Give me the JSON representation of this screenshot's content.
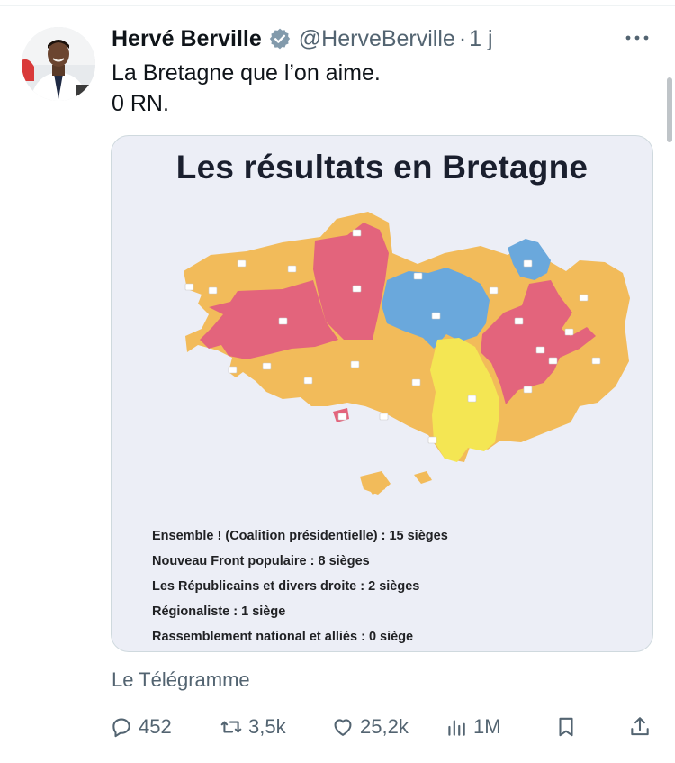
{
  "tweet": {
    "author_name": "Hervé Berville",
    "handle": "@HerveBerville",
    "separator": "·",
    "time": "1 j",
    "text_lines": [
      "La Bretagne que l’on aime.",
      "0 RN."
    ],
    "source_label": "Le Télégramme"
  },
  "media": {
    "title": "Les résultats en Bretagne",
    "legend": [
      "Ensemble ! (Coalition présidentielle) : 15 sièges",
      "Nouveau Front populaire : 8 sièges",
      "Les Républicains et divers droite : 2 sièges",
      "Régionaliste : 1 siège",
      "Rassemblement national et alliés : 0 siège"
    ],
    "colors": {
      "ensemble": "#f2bb5a",
      "nfp": "#e3647c",
      "lr": "#6aa8dc",
      "regionaliste": "#f4e653",
      "background": "#eceef6"
    }
  },
  "actions": {
    "replies": "452",
    "retweets": "3,5k",
    "likes": "25,2k",
    "views": "1M"
  },
  "icons": {
    "verified": "verified-badge-icon",
    "more": "more-options-icon",
    "reply": "reply-icon",
    "retweet": "retweet-icon",
    "like": "heart-icon",
    "views": "views-icon",
    "bookmark": "bookmark-icon",
    "share": "share-icon"
  }
}
